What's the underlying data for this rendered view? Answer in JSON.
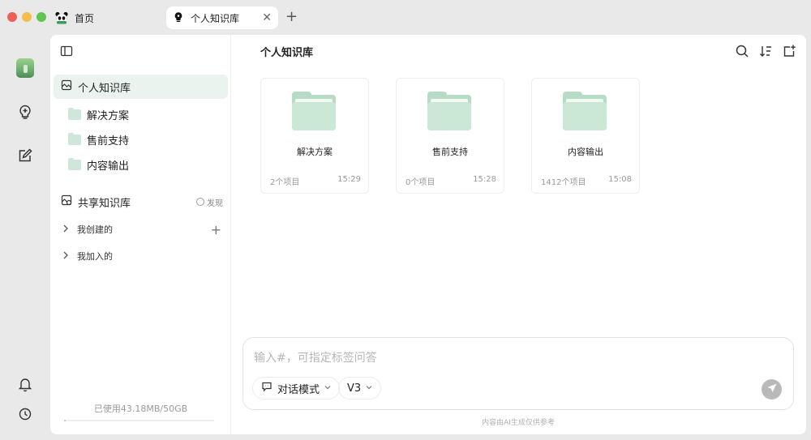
{
  "tabs": {
    "home_label": "首页",
    "active_label": "个人知识库",
    "close_glyph": "✕",
    "add_glyph": "+"
  },
  "sidebar": {
    "personal_kb_label": "个人知识库",
    "folders": [
      "解决方案",
      "售前支持",
      "内容输出"
    ],
    "shared_kb_label": "共享知识库",
    "discover_label": "发现",
    "created_label": "我创建的",
    "joined_label": "我加入的",
    "usage_text": "已使用43.18MB/50GB",
    "usage_fraction": 0.00084
  },
  "content": {
    "title": "个人知识库",
    "cards": [
      {
        "name": "解决方案",
        "count": "2个项目",
        "time": "15:29"
      },
      {
        "name": "售前支持",
        "count": "0个项目",
        "time": "15:28"
      },
      {
        "name": "内容输出",
        "count": "1412个项目",
        "time": "15:08"
      }
    ]
  },
  "input": {
    "placeholder": "输入#，可指定标签问答",
    "mode_label": "对话模式",
    "version_label": "V3",
    "disclaimer": "内容由AI生成仅供参考"
  },
  "colors": {
    "accent_green": "#b6dcc6",
    "selected_bg": "#eaf3ee"
  }
}
